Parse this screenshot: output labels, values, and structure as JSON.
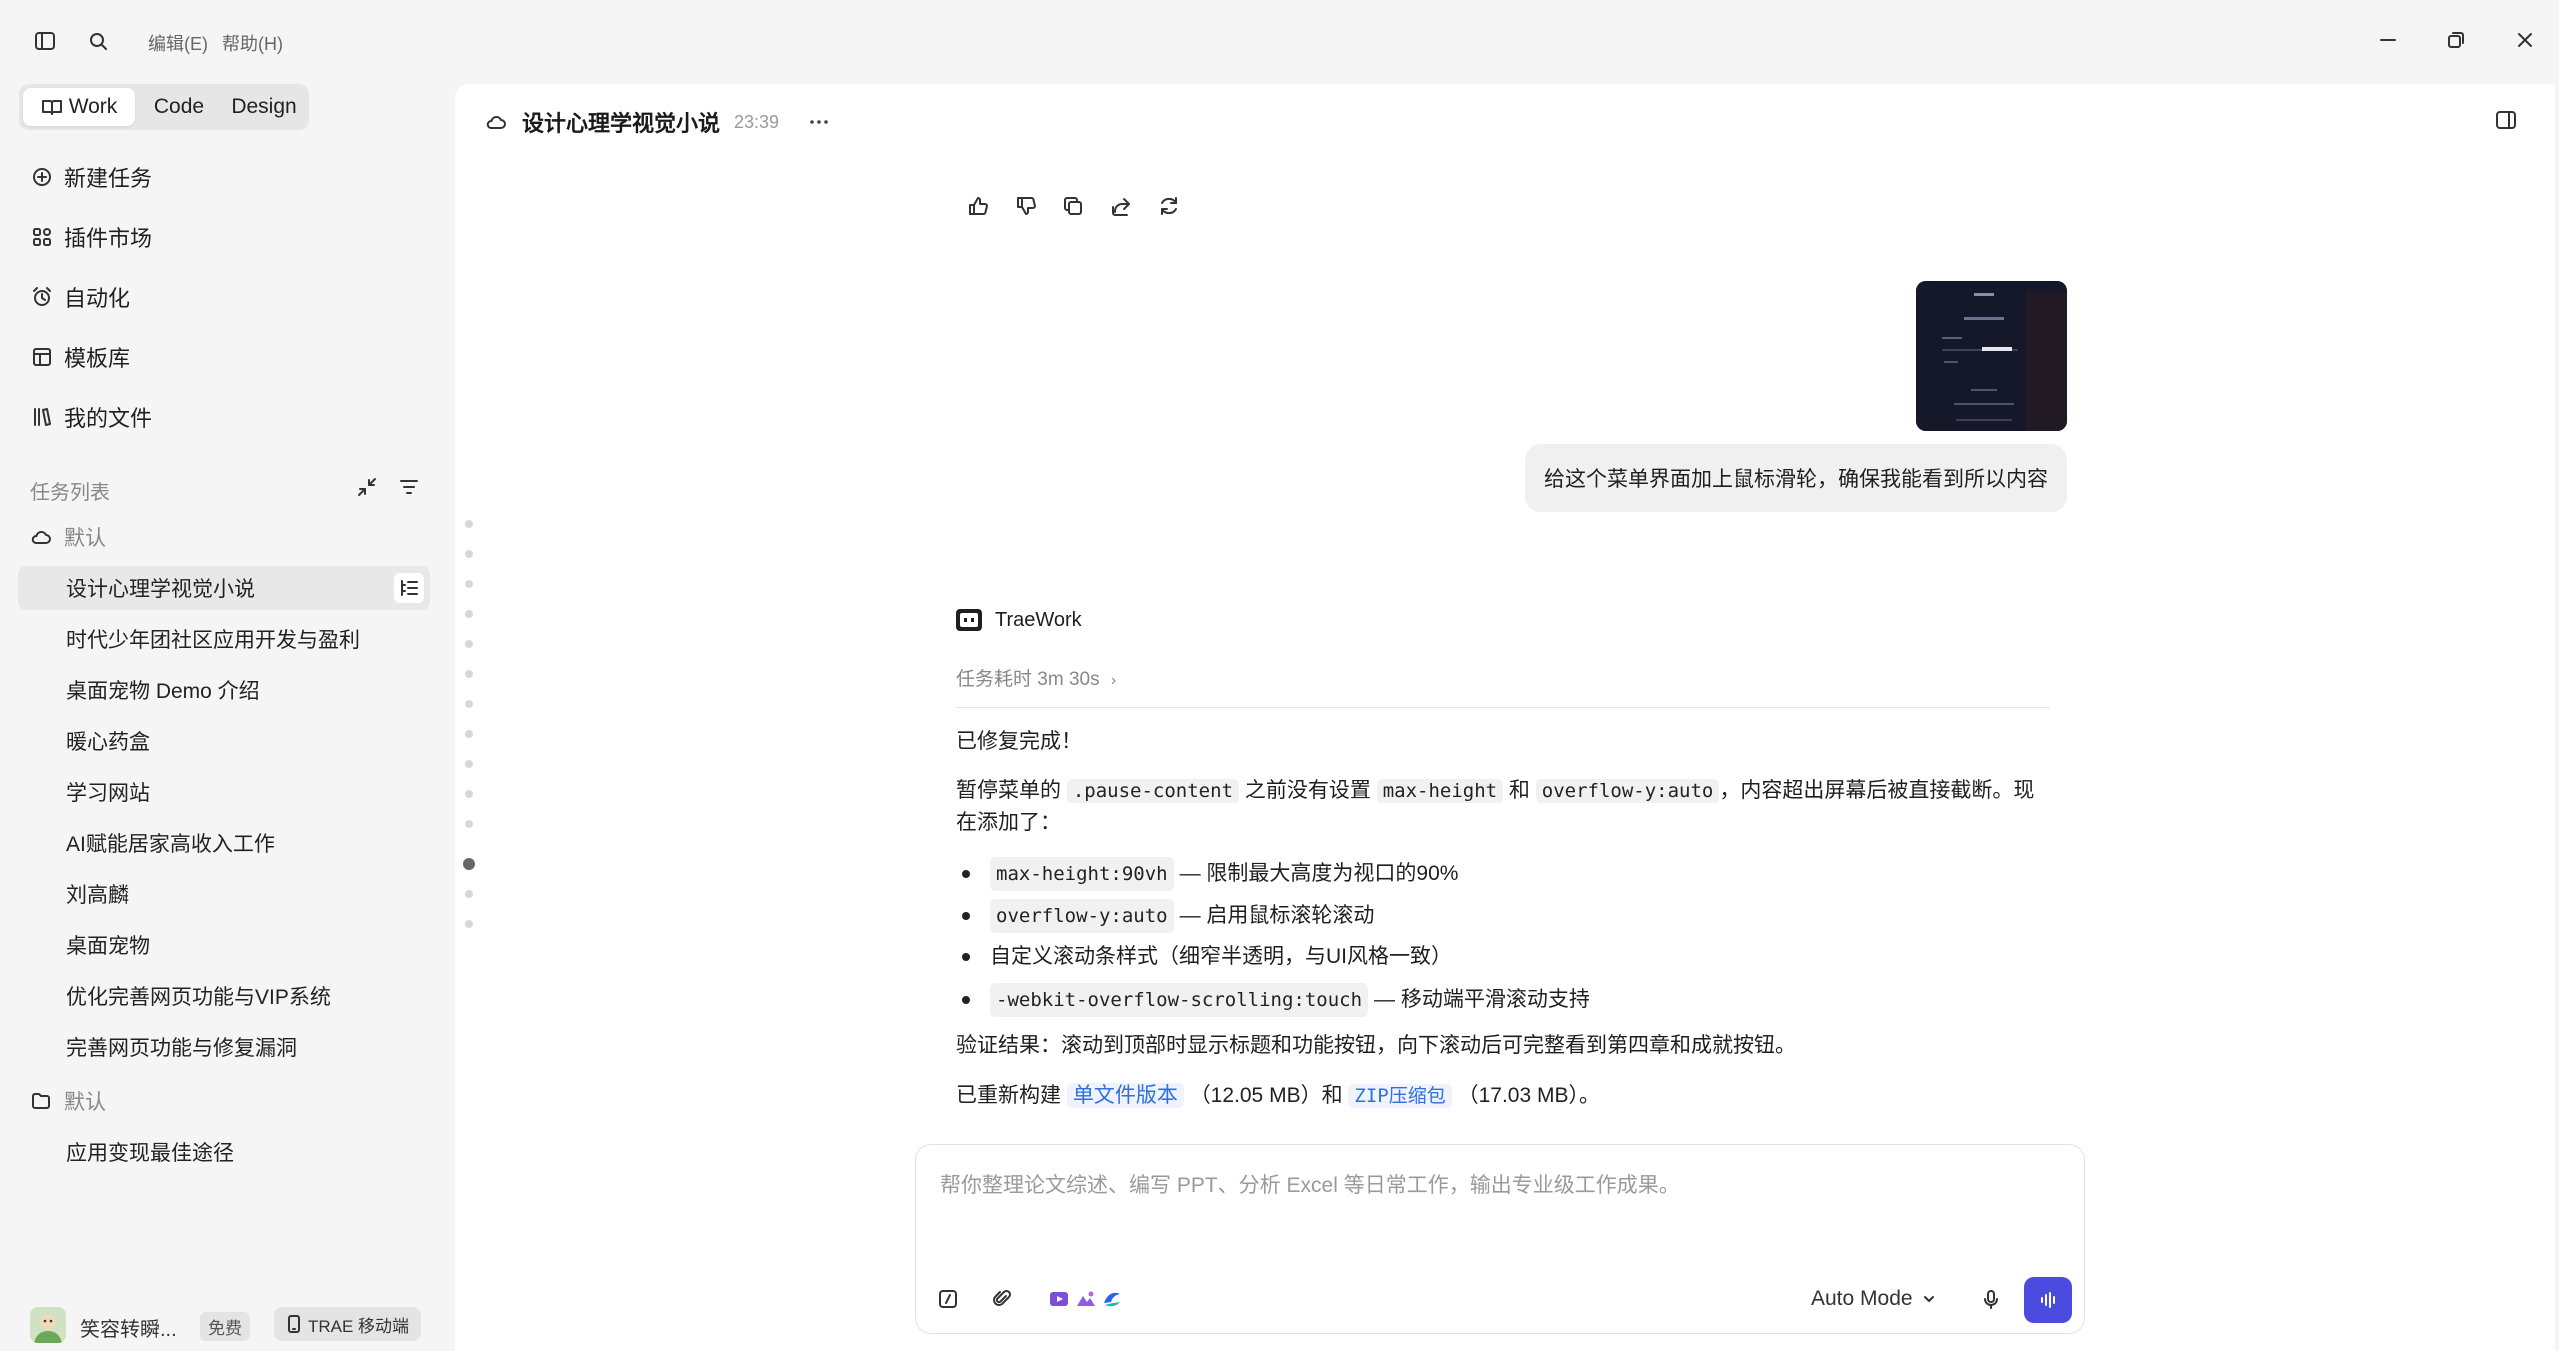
{
  "menu": {
    "edit": "编辑(E)",
    "help": "帮助(H)"
  },
  "modes": {
    "work": "Work",
    "code": "Code",
    "design": "Design"
  },
  "nav": {
    "new_task": "新建任务",
    "plugin_market": "插件市场",
    "automation": "自动化",
    "templates": "模板库",
    "my_files": "我的文件"
  },
  "tasks": {
    "header": "任务列表",
    "groups": [
      {
        "label": "默认",
        "items": [
          "设计心理学视觉小说",
          "时代少年团社区应用开发与盈利",
          "桌面宠物 Demo 介绍",
          "暖心药盒",
          "学习网站",
          "AI赋能居家高收入工作",
          "刘高麟",
          "桌面宠物",
          "优化完善网页功能与VIP系统",
          "完善网页功能与修复漏洞"
        ]
      },
      {
        "label": "默认",
        "items": [
          "应用变现最佳途径"
        ]
      }
    ]
  },
  "user": {
    "name": "笑容转瞬...",
    "plan": "免费",
    "mobile": "TRAE 移动端"
  },
  "header": {
    "title": "设计心理学视觉小说",
    "time": "23:39"
  },
  "conversation": {
    "user_message": "给这个菜单界面加上鼠标滑轮，确保我能看到所以内容",
    "bot_name": "TraeWork",
    "task_duration": "任务耗时 3m 30s",
    "reply": {
      "line1": "已修复完成！",
      "p2_a": "暂停菜单的",
      "p2_code1": ".pause-content",
      "p2_b": "之前没有设置",
      "p2_code2": "max-height",
      "p2_c": "和",
      "p2_code3": "overflow-y:auto",
      "p2_d": "，内容超出屏幕后被直接截断。现",
      "p2_e": "在添加了：",
      "bullets": [
        {
          "code": "max-height:90vh",
          "text": "— 限制最大高度为视口的90%"
        },
        {
          "code": "overflow-y:auto",
          "text": "— 启用鼠标滚轮滚动"
        },
        {
          "code": "",
          "text": "自定义滚动条样式（细窄半透明，与UI风格一致）"
        },
        {
          "code": "-webkit-overflow-scrolling:touch",
          "text": "— 移动端平滑滚动支持"
        }
      ],
      "verify": "验证结果：滚动到顶部时显示标题和功能按钮，向下滚动后可完整看到第四章和成就按钮。",
      "rebuild_a": "已重新构建",
      "rebuild_link1": "单文件版本",
      "rebuild_b": "（12.05 MB）和",
      "rebuild_link2": "ZIP压缩包",
      "rebuild_c": "（17.03 MB）。"
    }
  },
  "composer": {
    "placeholder": "帮你整理论文综述、编写 PPT、分析 Excel 等日常工作，输出专业级工作成果。",
    "mode": "Auto Mode"
  },
  "colors": {
    "accent": "#4b4bdf",
    "link": "#2f6fe0"
  }
}
